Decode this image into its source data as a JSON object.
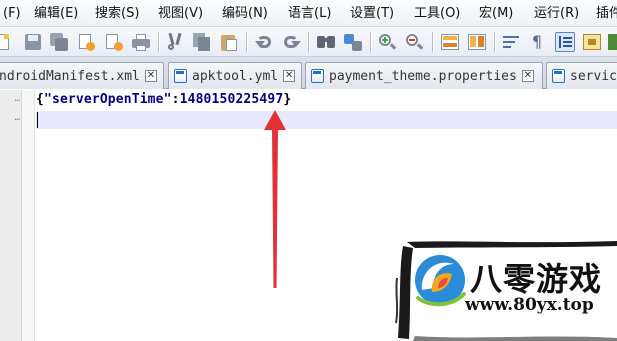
{
  "menu": {
    "items": [
      "(F)",
      "编辑(E)",
      "搜索(S)",
      "视图(V)",
      "编码(N)",
      "语言(L)",
      "设置(T)",
      "工具(O)",
      "宏(M)",
      "运行(R)",
      "插件"
    ]
  },
  "tabs": [
    {
      "label": "ndroidManifest.xml",
      "has_icon": false
    },
    {
      "label": "apktool.yml",
      "has_icon": true
    },
    {
      "label": "payment_theme.properties",
      "has_icon": true
    },
    {
      "label": "servic",
      "has_icon": true
    }
  ],
  "tab_close_glyph": "✕",
  "editor": {
    "line1": {
      "open_brace": "{",
      "key": "\"serverOpenTime\"",
      "colon": ":",
      "value": "1480150225497",
      "close_brace": "}"
    }
  },
  "annotation": {
    "arrow_color": "#e03038"
  },
  "watermark": {
    "title": "八零游戏",
    "url": "www.80yx.top"
  },
  "colors": {
    "menubar": "#f3f5f9",
    "current_line": "#e8e8ff",
    "code_text": "#000080",
    "tab_icon": "#2b6cc4"
  }
}
